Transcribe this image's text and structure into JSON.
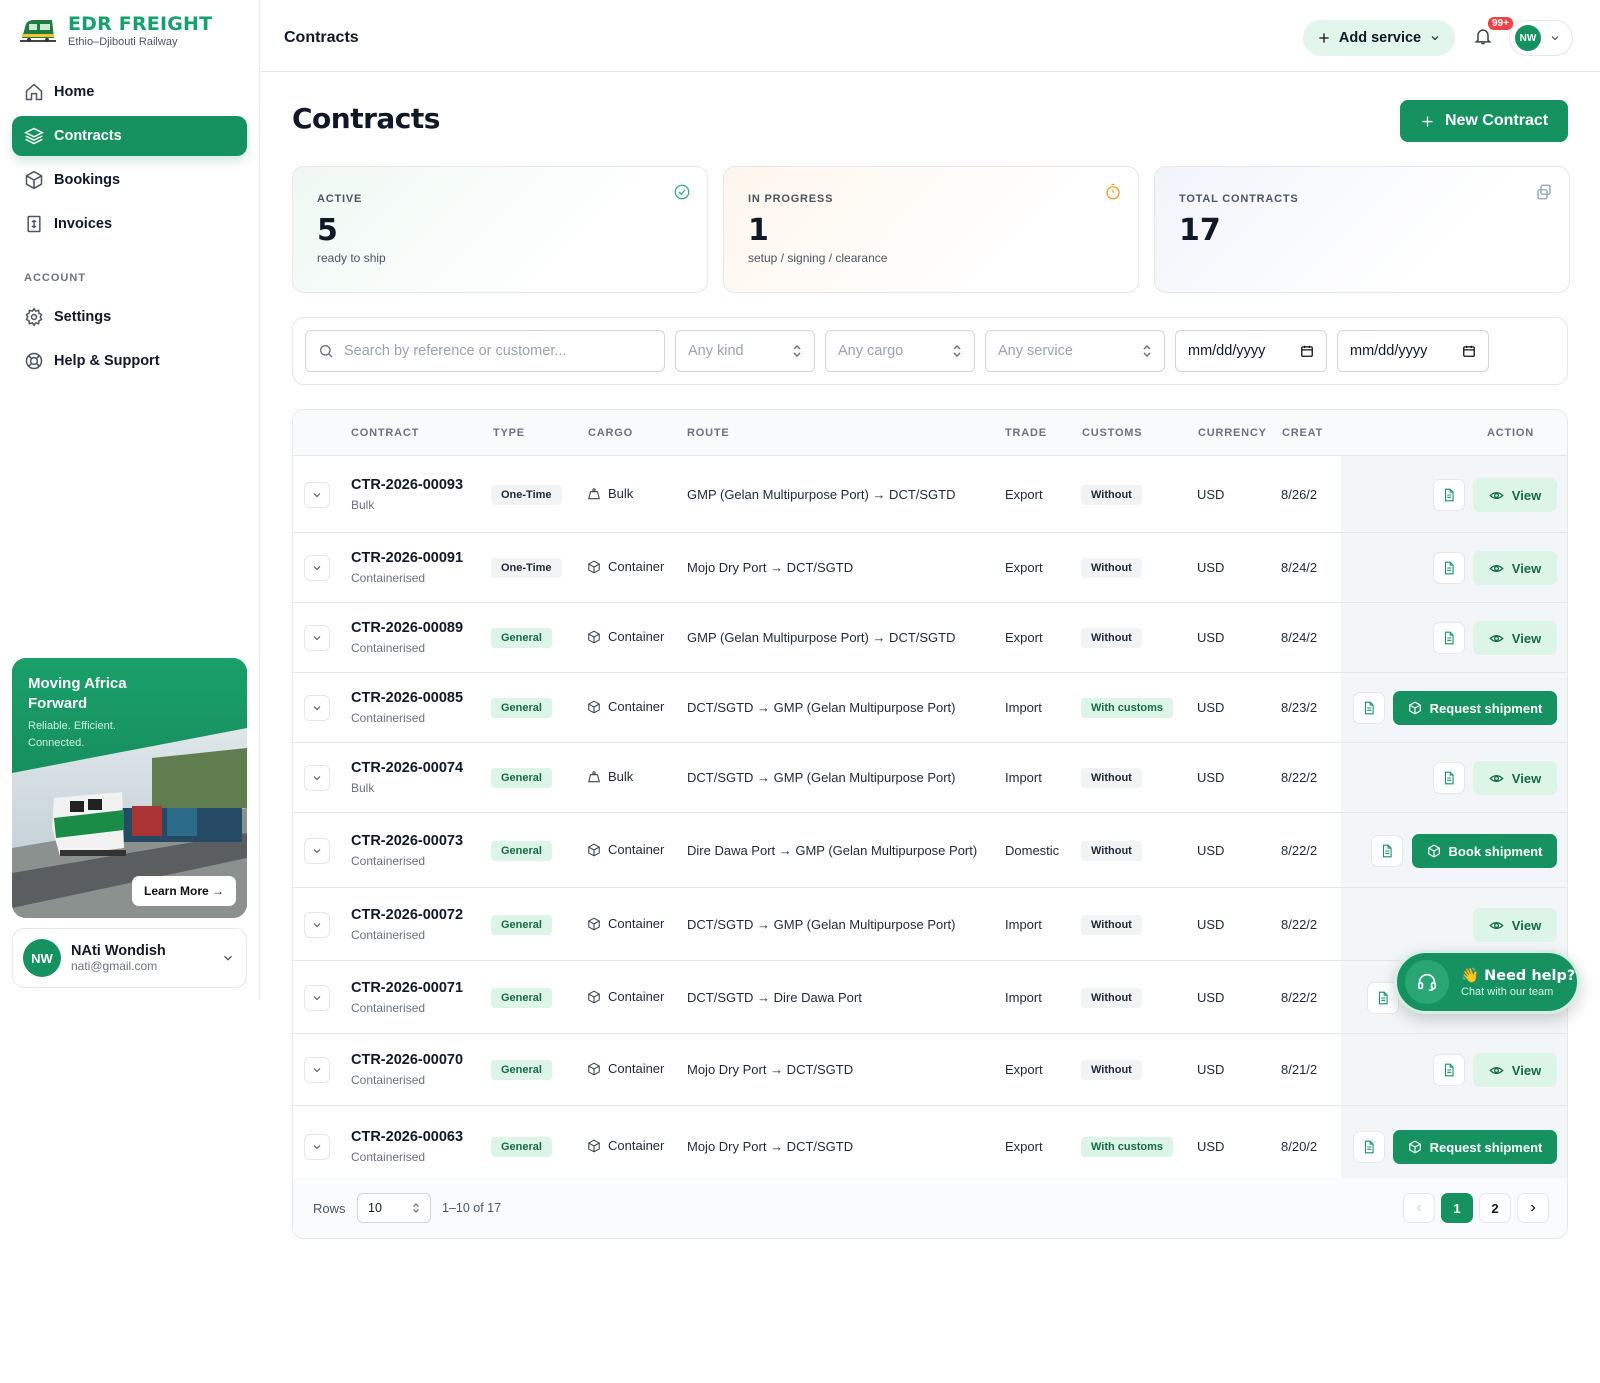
{
  "brand": {
    "name": "EDR FREIGHT",
    "subtitle": "Ethio–Djibouti Railway"
  },
  "sidebar": {
    "nav": [
      {
        "label": "Home",
        "icon": "home-icon",
        "active": false
      },
      {
        "label": "Contracts",
        "icon": "layers-icon",
        "active": true
      },
      {
        "label": "Bookings",
        "icon": "package-icon",
        "active": false
      },
      {
        "label": "Invoices",
        "icon": "receipt-icon",
        "active": false
      }
    ],
    "account_label": "ACCOUNT",
    "account_nav": [
      {
        "label": "Settings",
        "icon": "gear-icon"
      },
      {
        "label": "Help & Support",
        "icon": "lifebuoy-icon"
      }
    ],
    "promo": {
      "title": "Moving Africa Forward",
      "subtitle": "Reliable. Efficient. Connected.",
      "button": "Learn More →"
    },
    "user": {
      "initials": "NW",
      "name": "NAti Wondish",
      "email": "nati@gmail.com"
    }
  },
  "topbar": {
    "title": "Contracts",
    "add_service": "Add service",
    "notification_count": "99+",
    "user_initials": "NW"
  },
  "page": {
    "title": "Contracts",
    "new_button": "New Contract"
  },
  "stats": [
    {
      "label": "ACTIVE",
      "value": "5",
      "sub": "ready to ship",
      "icon": "check-circle-icon"
    },
    {
      "label": "IN PROGRESS",
      "value": "1",
      "sub": "setup / signing / clearance",
      "icon": "timer-icon"
    },
    {
      "label": "TOTAL CONTRACTS",
      "value": "17",
      "sub": "",
      "icon": "copy-icon"
    }
  ],
  "filters": {
    "search_placeholder": "Search by reference or customer...",
    "kind": "Any kind",
    "cargo": "Any cargo",
    "service": "Any service",
    "date_from": "mm/dd/yyyy",
    "date_to": "mm/dd/yyyy"
  },
  "table": {
    "columns": [
      "CONTRACT",
      "TYPE",
      "CARGO",
      "ROUTE",
      "TRADE",
      "CUSTOMS",
      "CURRENCY",
      "CREAT",
      "ACTION"
    ],
    "rows": [
      {
        "ref": "CTR-2026-00093",
        "sub": "Bulk",
        "type": "One-Time",
        "cargo": "Bulk",
        "route": "GMP (Gelan Multipurpose Port) → DCT/SGTD",
        "trade": "Export",
        "customs": "Without",
        "currency": "USD",
        "created": "8/26/2",
        "action": "View",
        "doc": true
      },
      {
        "ref": "CTR-2026-00091",
        "sub": "Containerised",
        "type": "One-Time",
        "cargo": "Container",
        "route": "Mojo Dry Port → DCT/SGTD",
        "trade": "Export",
        "customs": "Without",
        "currency": "USD",
        "created": "8/24/2",
        "action": "View",
        "doc": true
      },
      {
        "ref": "CTR-2026-00089",
        "sub": "Containerised",
        "type": "General",
        "cargo": "Container",
        "route": "GMP (Gelan Multipurpose Port) → DCT/SGTD",
        "trade": "Export",
        "customs": "Without",
        "currency": "USD",
        "created": "8/24/2",
        "action": "View",
        "doc": true
      },
      {
        "ref": "CTR-2026-00085",
        "sub": "Containerised",
        "type": "General",
        "cargo": "Container",
        "route": "DCT/SGTD → GMP (Gelan Multipurpose Port)",
        "trade": "Import",
        "customs": "With customs",
        "currency": "USD",
        "created": "8/23/2",
        "action": "Request shipment",
        "doc": true
      },
      {
        "ref": "CTR-2026-00074",
        "sub": "Bulk",
        "type": "General",
        "cargo": "Bulk",
        "route": "DCT/SGTD → GMP (Gelan Multipurpose Port)",
        "trade": "Import",
        "customs": "Without",
        "currency": "USD",
        "created": "8/22/2",
        "action": "View",
        "doc": true
      },
      {
        "ref": "CTR-2026-00073",
        "sub": "Containerised",
        "type": "General",
        "cargo": "Container",
        "route": "Dire Dawa Port → GMP (Gelan Multipurpose Port)",
        "trade": "Domestic",
        "customs": "Without",
        "currency": "USD",
        "created": "8/22/2",
        "action": "Book shipment",
        "doc": true
      },
      {
        "ref": "CTR-2026-00072",
        "sub": "Containerised",
        "type": "General",
        "cargo": "Container",
        "route": "DCT/SGTD → GMP (Gelan Multipurpose Port)",
        "trade": "Import",
        "customs": "Without",
        "currency": "USD",
        "created": "8/22/2",
        "action": "View",
        "doc": false
      },
      {
        "ref": "CTR-2026-00071",
        "sub": "Containerised",
        "type": "General",
        "cargo": "Container",
        "route": "DCT/SGTD → Dire Dawa Port",
        "trade": "Import",
        "customs": "Without",
        "currency": "USD",
        "created": "8/22/2",
        "action": "",
        "doc": true
      },
      {
        "ref": "CTR-2026-00070",
        "sub": "Containerised",
        "type": "General",
        "cargo": "Container",
        "route": "Mojo Dry Port → DCT/SGTD",
        "trade": "Export",
        "customs": "Without",
        "currency": "USD",
        "created": "8/21/2",
        "action": "View",
        "doc": true
      },
      {
        "ref": "CTR-2026-00063",
        "sub": "Containerised",
        "type": "General",
        "cargo": "Container",
        "route": "Mojo Dry Port → DCT/SGTD",
        "trade": "Export",
        "customs": "With customs",
        "currency": "USD",
        "created": "8/20/2",
        "action": "Request shipment",
        "doc": true
      }
    ]
  },
  "pagination": {
    "rows_label": "Rows",
    "rows_value": "10",
    "range": "1–10 of 17",
    "pages": [
      "1",
      "2"
    ],
    "current": "1"
  },
  "help_widget": {
    "title": "👋 Need help?",
    "subtitle": "Chat with our team"
  },
  "colors": {
    "primary": "#15925f",
    "primary_light": "#dcf5e7",
    "text": "#111827",
    "muted": "#6b7280"
  }
}
